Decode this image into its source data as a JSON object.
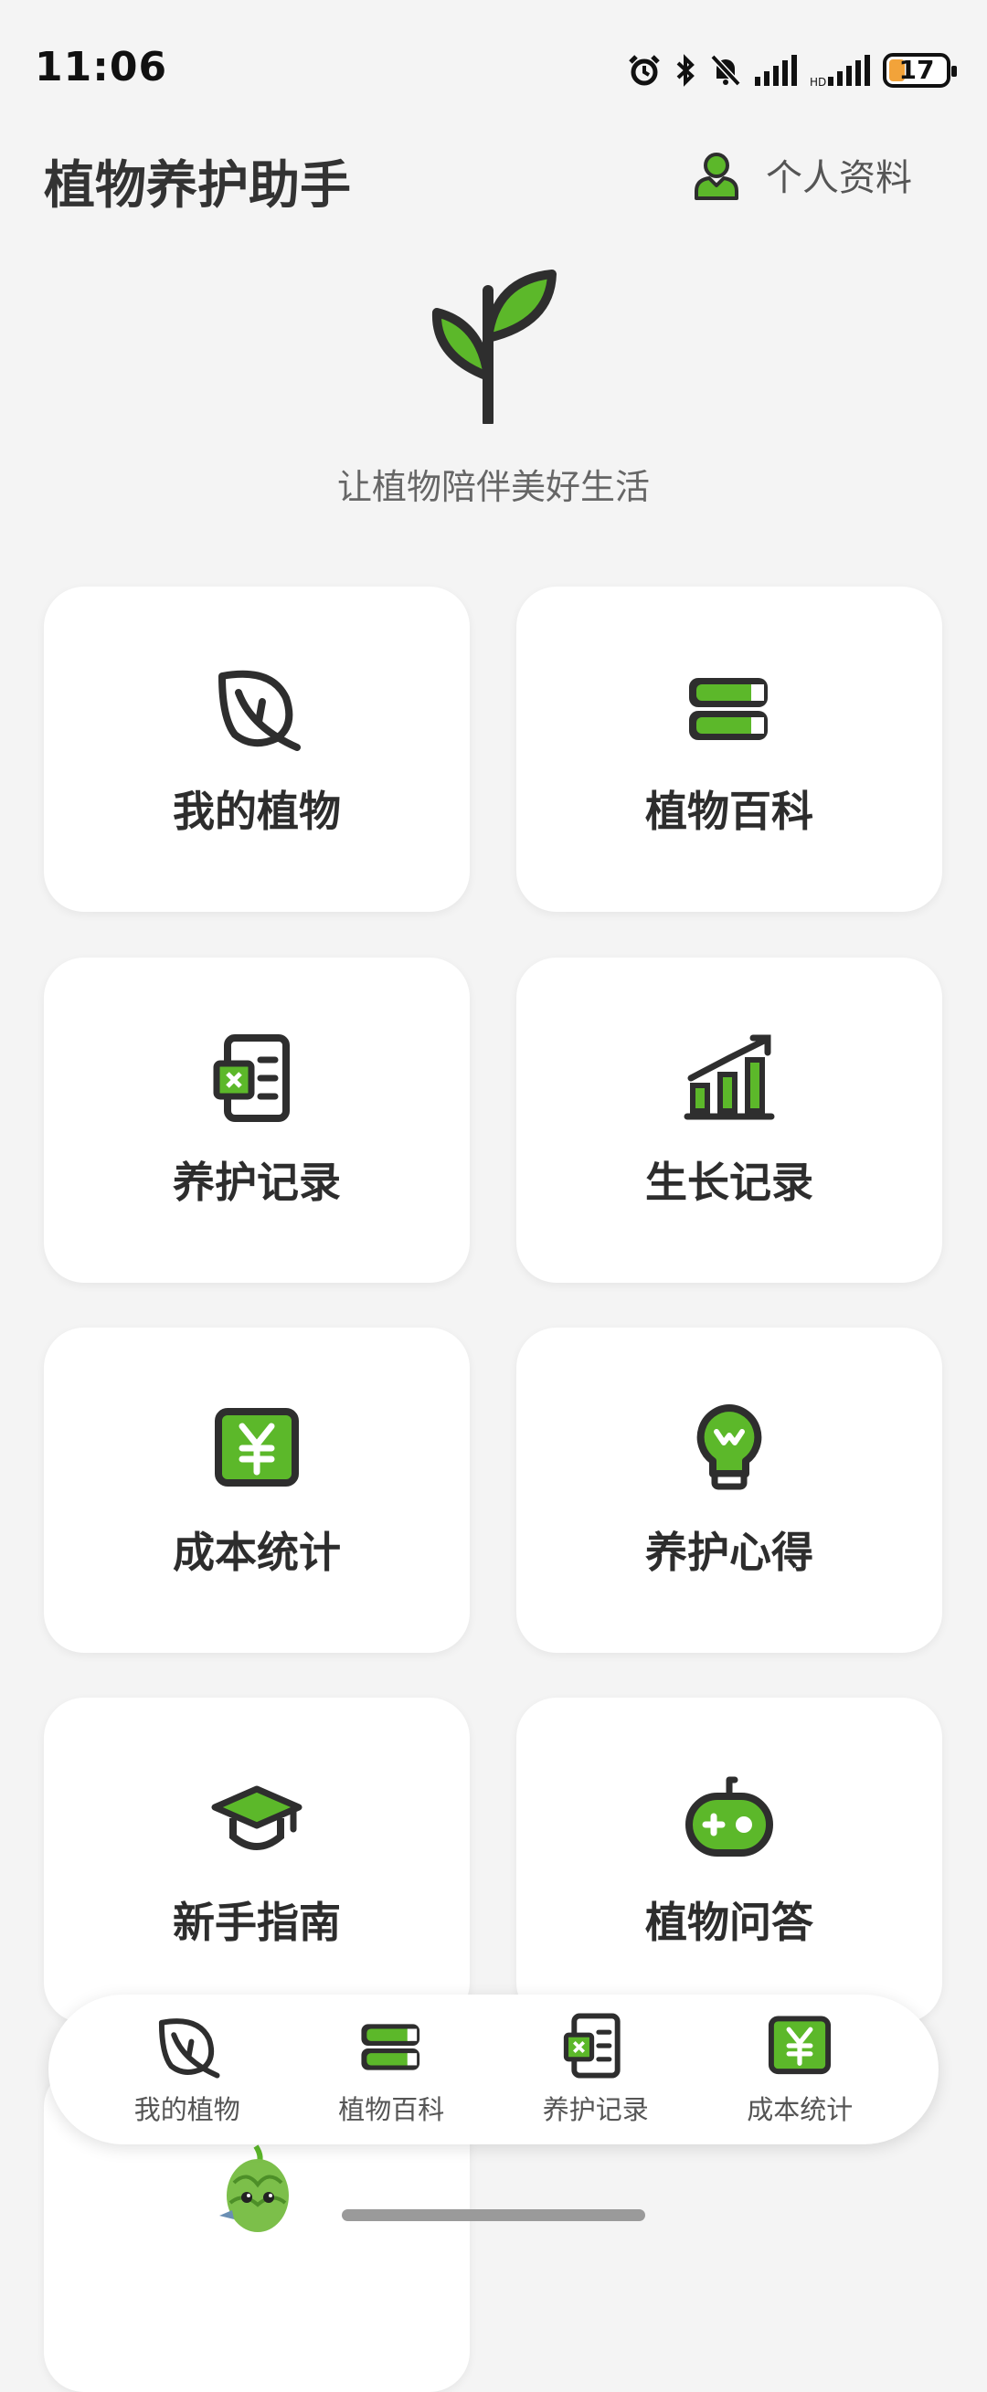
{
  "status_bar": {
    "time": "11:06",
    "battery_level": "17"
  },
  "header": {
    "title": "植物养护助手",
    "profile_label": "个人资料"
  },
  "hero": {
    "slogan": "让植物陪伴美好生活"
  },
  "colors": {
    "accent": "#5cb82a",
    "dark": "#2e2e2e",
    "background": "#f4f4f4"
  },
  "grid": [
    {
      "label": "我的植物",
      "icon": "leaf-icon"
    },
    {
      "label": "植物百科",
      "icon": "books-icon"
    },
    {
      "label": "养护记录",
      "icon": "care-record-icon"
    },
    {
      "label": "生长记录",
      "icon": "growth-chart-icon"
    },
    {
      "label": "成本统计",
      "icon": "yuan-icon"
    },
    {
      "label": "养护心得",
      "icon": "lightbulb-icon"
    },
    {
      "label": "新手指南",
      "icon": "graduation-cap-icon"
    },
    {
      "label": "植物问答",
      "icon": "gamepad-icon"
    }
  ],
  "bottom_nav": [
    {
      "label": "我的植物",
      "icon": "leaf-icon"
    },
    {
      "label": "植物百科",
      "icon": "books-icon"
    },
    {
      "label": "养护记录",
      "icon": "care-record-icon"
    },
    {
      "label": "成本统计",
      "icon": "yuan-icon"
    }
  ]
}
